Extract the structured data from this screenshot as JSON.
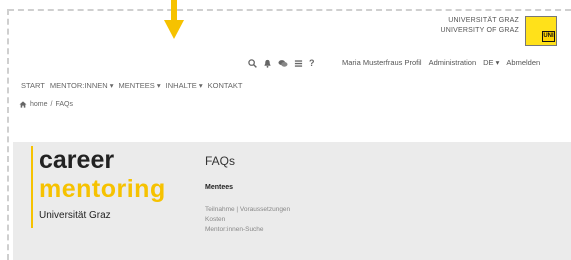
{
  "header": {
    "university_line1": "UNIVERSITÄT GRAZ",
    "university_line2": "UNIVERSITY OF GRAZ",
    "logo_text": "UNI",
    "accent_color": "#f6c200"
  },
  "toolbar": {
    "icons": [
      "search-icon",
      "bell-icon",
      "chat-icon",
      "list-icon",
      "help-icon"
    ],
    "help_glyph": "?"
  },
  "user_menu": {
    "profile": "Maria Musterfraus Profil",
    "administration": "Administration",
    "language": "DE ▾",
    "logout": "Abmelden"
  },
  "nav": {
    "items": [
      {
        "label": "START"
      },
      {
        "label": "MENTOR:INNEN ▾"
      },
      {
        "label": "MENTEES ▾"
      },
      {
        "label": "INHALTE ▾"
      },
      {
        "label": "KONTAKT"
      }
    ]
  },
  "breadcrumb": {
    "home": "home",
    "separator": "/",
    "current": "FAQs"
  },
  "brand": {
    "career": "career",
    "mentoring": "mentoring",
    "university": "Universität Graz"
  },
  "main": {
    "title": "FAQs",
    "section_title": "Mentees",
    "links": [
      "Teilnahme | Voraussetzungen",
      "Kosten",
      "Mentor:innen-Suche"
    ]
  }
}
